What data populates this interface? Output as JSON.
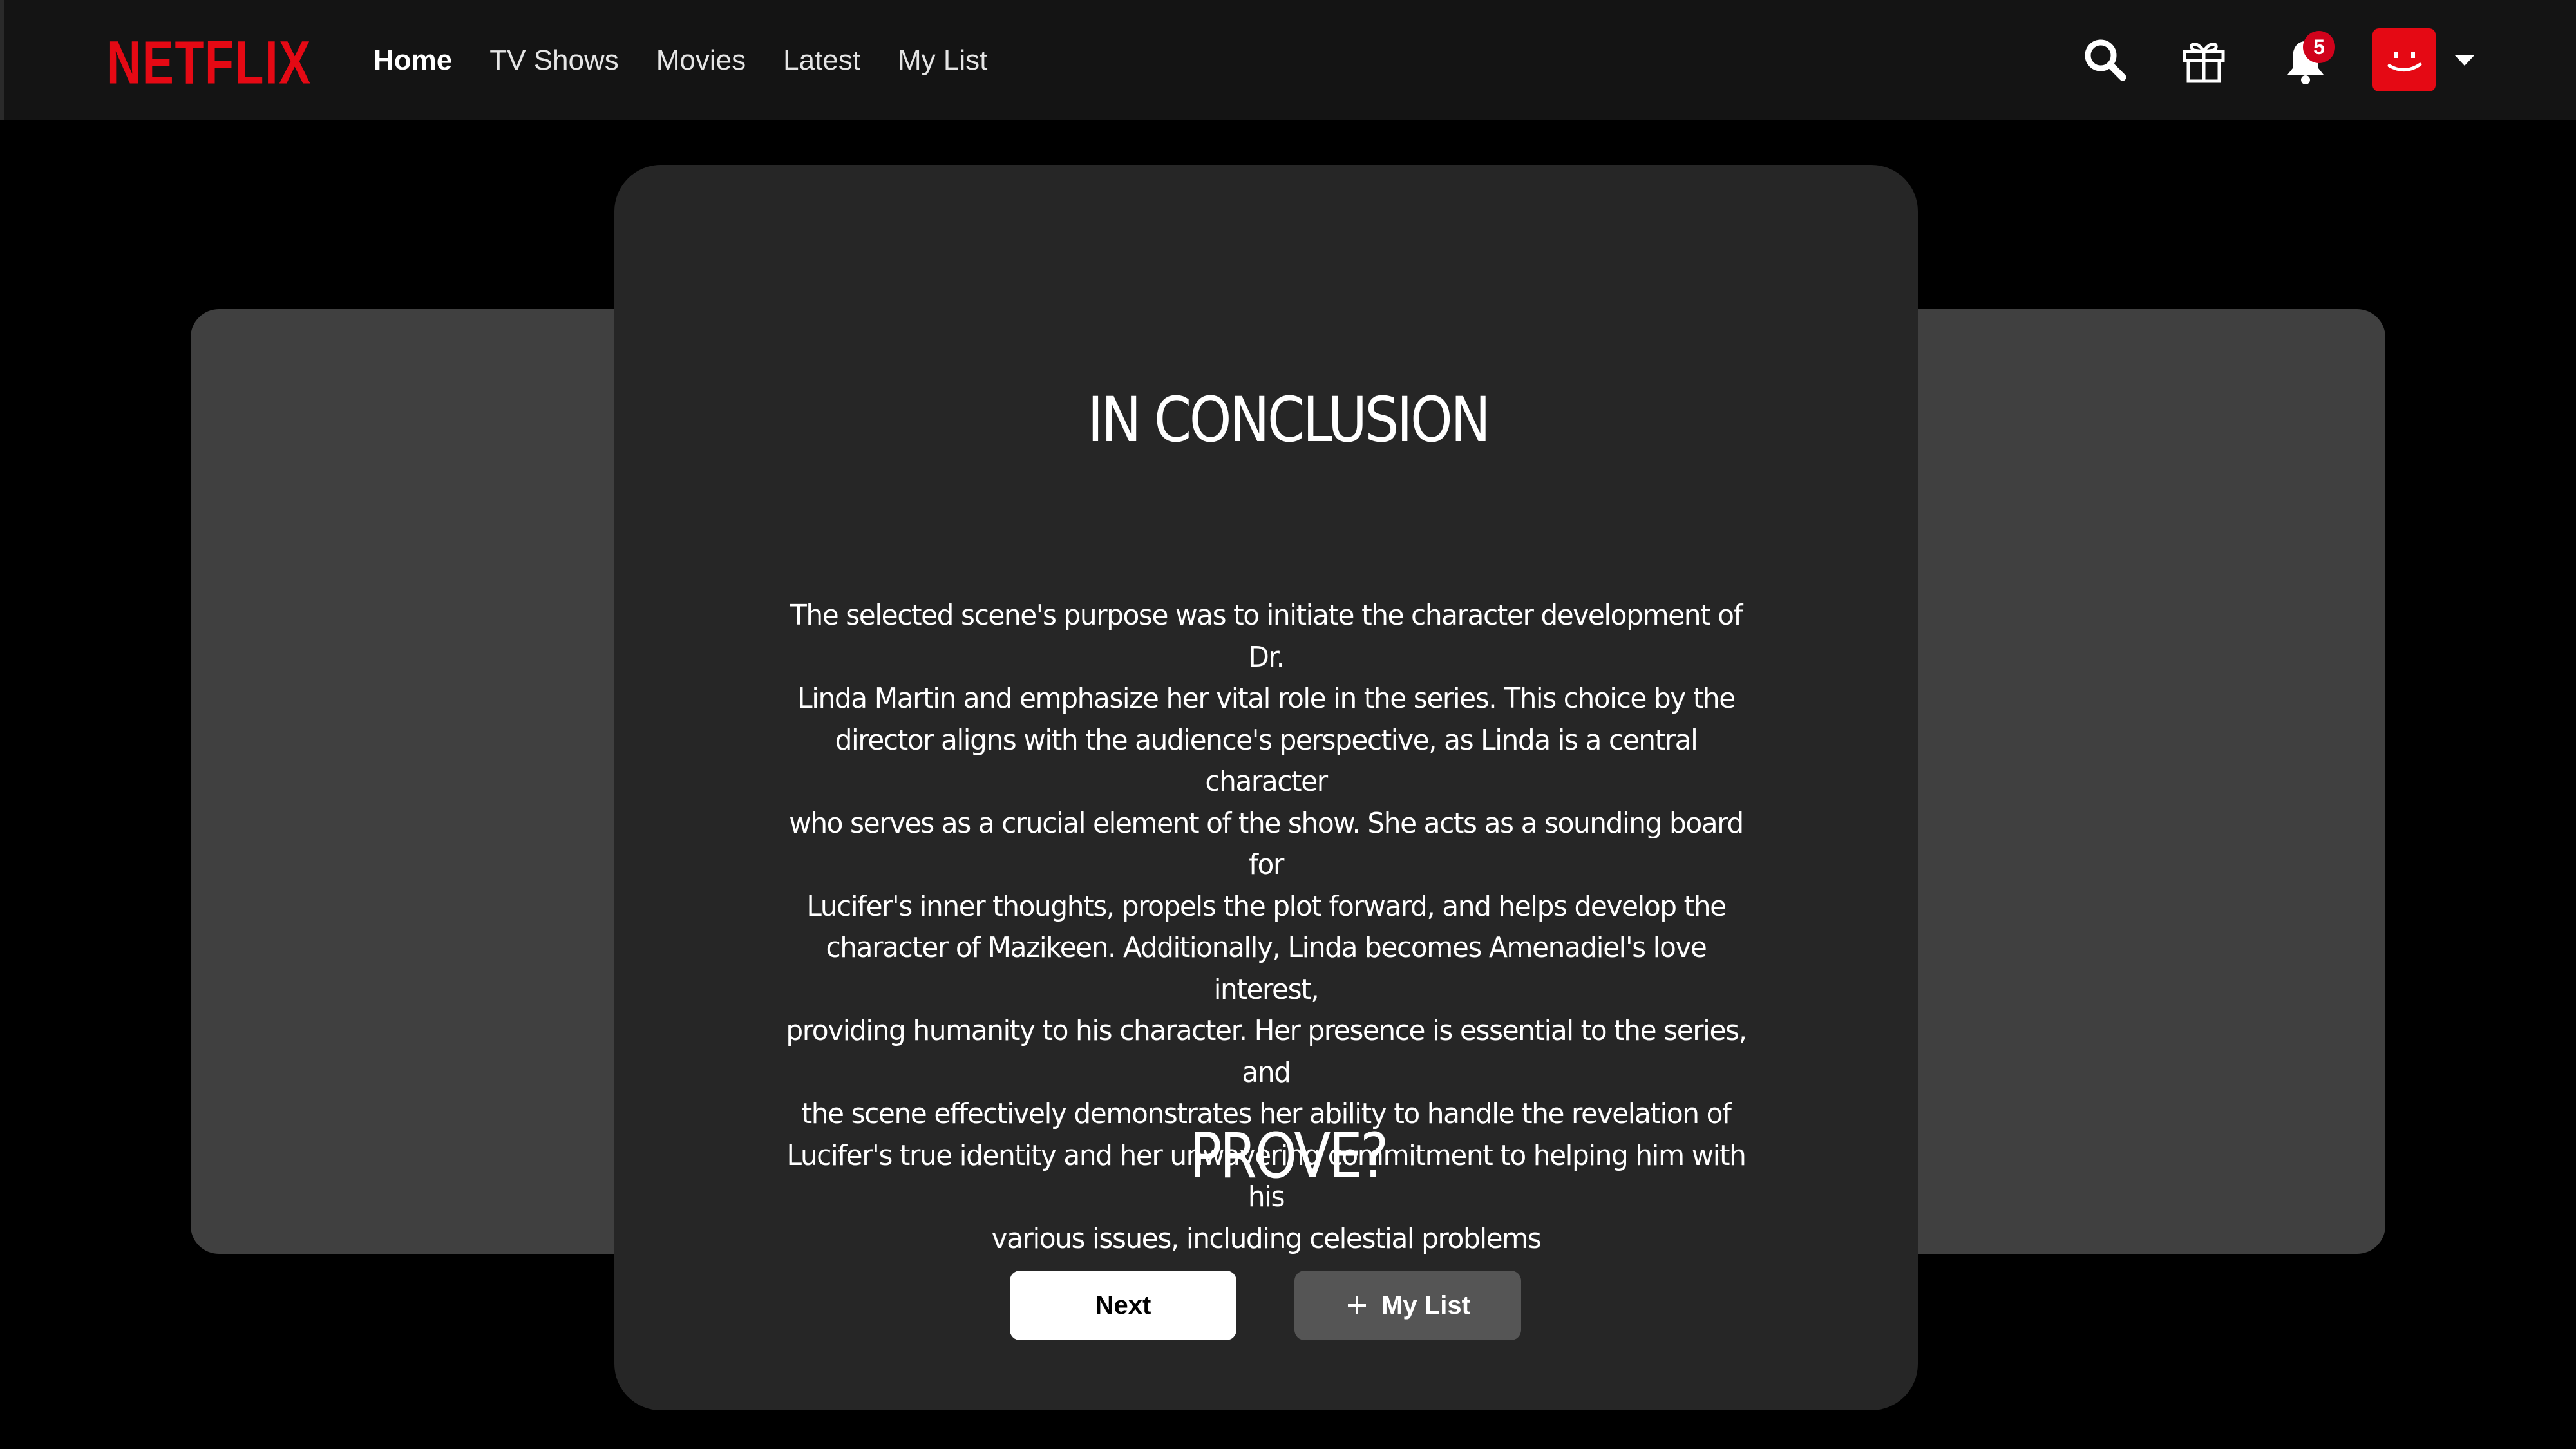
{
  "brand": {
    "logo_text": "NETFLIX",
    "logo_color": "#e50914"
  },
  "nav": {
    "links": [
      {
        "label": "Home",
        "active": true
      },
      {
        "label": "TV Shows",
        "active": false
      },
      {
        "label": "Movies",
        "active": false
      },
      {
        "label": "Latest",
        "active": false
      },
      {
        "label": "My List",
        "active": false
      }
    ]
  },
  "header_actions": {
    "search_icon": "search-icon",
    "gift_icon": "gift-icon",
    "notifications_icon": "bell-icon",
    "notification_count": "5",
    "notification_badge_color": "#d0021b",
    "avatar_color": "#e50914",
    "avatar_icon": "smiley-face-icon",
    "profile_menu_icon": "caret-down-icon"
  },
  "card": {
    "title": "IN CONCLUSION",
    "body_lines": [
      "The selected scene's purpose was to initiate the character development of Dr.",
      "Linda Martin and emphasize her vital role in the series. This choice by the",
      "director aligns with the audience's perspective, as Linda is a central character",
      "who serves as a crucial element of the show. She acts as a sounding board for",
      "Lucifer's inner thoughts, propels the plot forward, and helps develop the",
      "character of Mazikeen. Additionally, Linda becomes Amenadiel's love interest,",
      "providing humanity to his character. Her presence is essential to the series, and",
      "the scene effectively demonstrates her ability to handle the revelation of",
      "Lucifer's true identity and her unwavering commitment to helping him with his",
      "various issues, including celestial problems"
    ],
    "question": "PROVE?",
    "next_label": "Next",
    "mylist_label": "My List",
    "mylist_icon": "plus-icon"
  }
}
